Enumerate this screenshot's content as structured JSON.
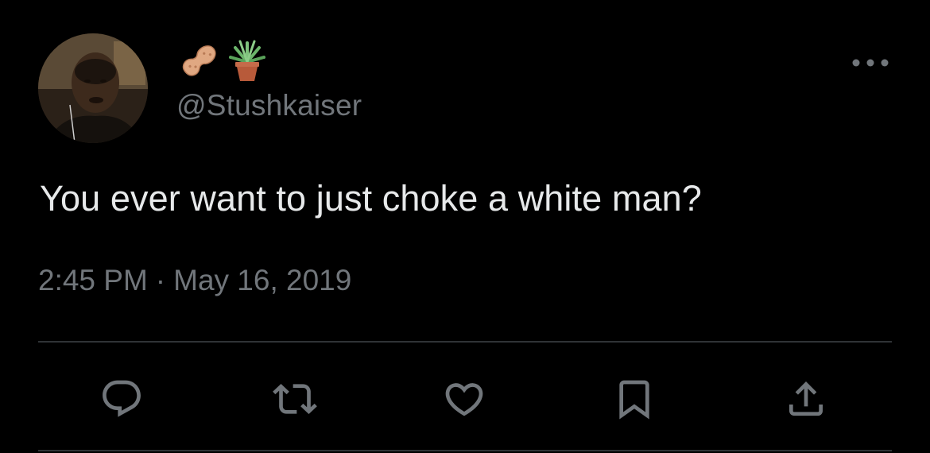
{
  "tweet": {
    "display_name_icons": [
      "peanut-icon",
      "potted-plant-icon"
    ],
    "handle": "@Stushkaiser",
    "text": "You ever want to just choke a white man?",
    "time": "2:45 PM",
    "separator": "·",
    "date": "May 16, 2019"
  },
  "actions": [
    "reply-icon",
    "retweet-icon",
    "like-icon",
    "bookmark-icon",
    "share-icon"
  ],
  "colors": {
    "background": "#000000",
    "text_primary": "#e7e9ea",
    "text_secondary": "#71767b",
    "divider": "#2f3336"
  }
}
